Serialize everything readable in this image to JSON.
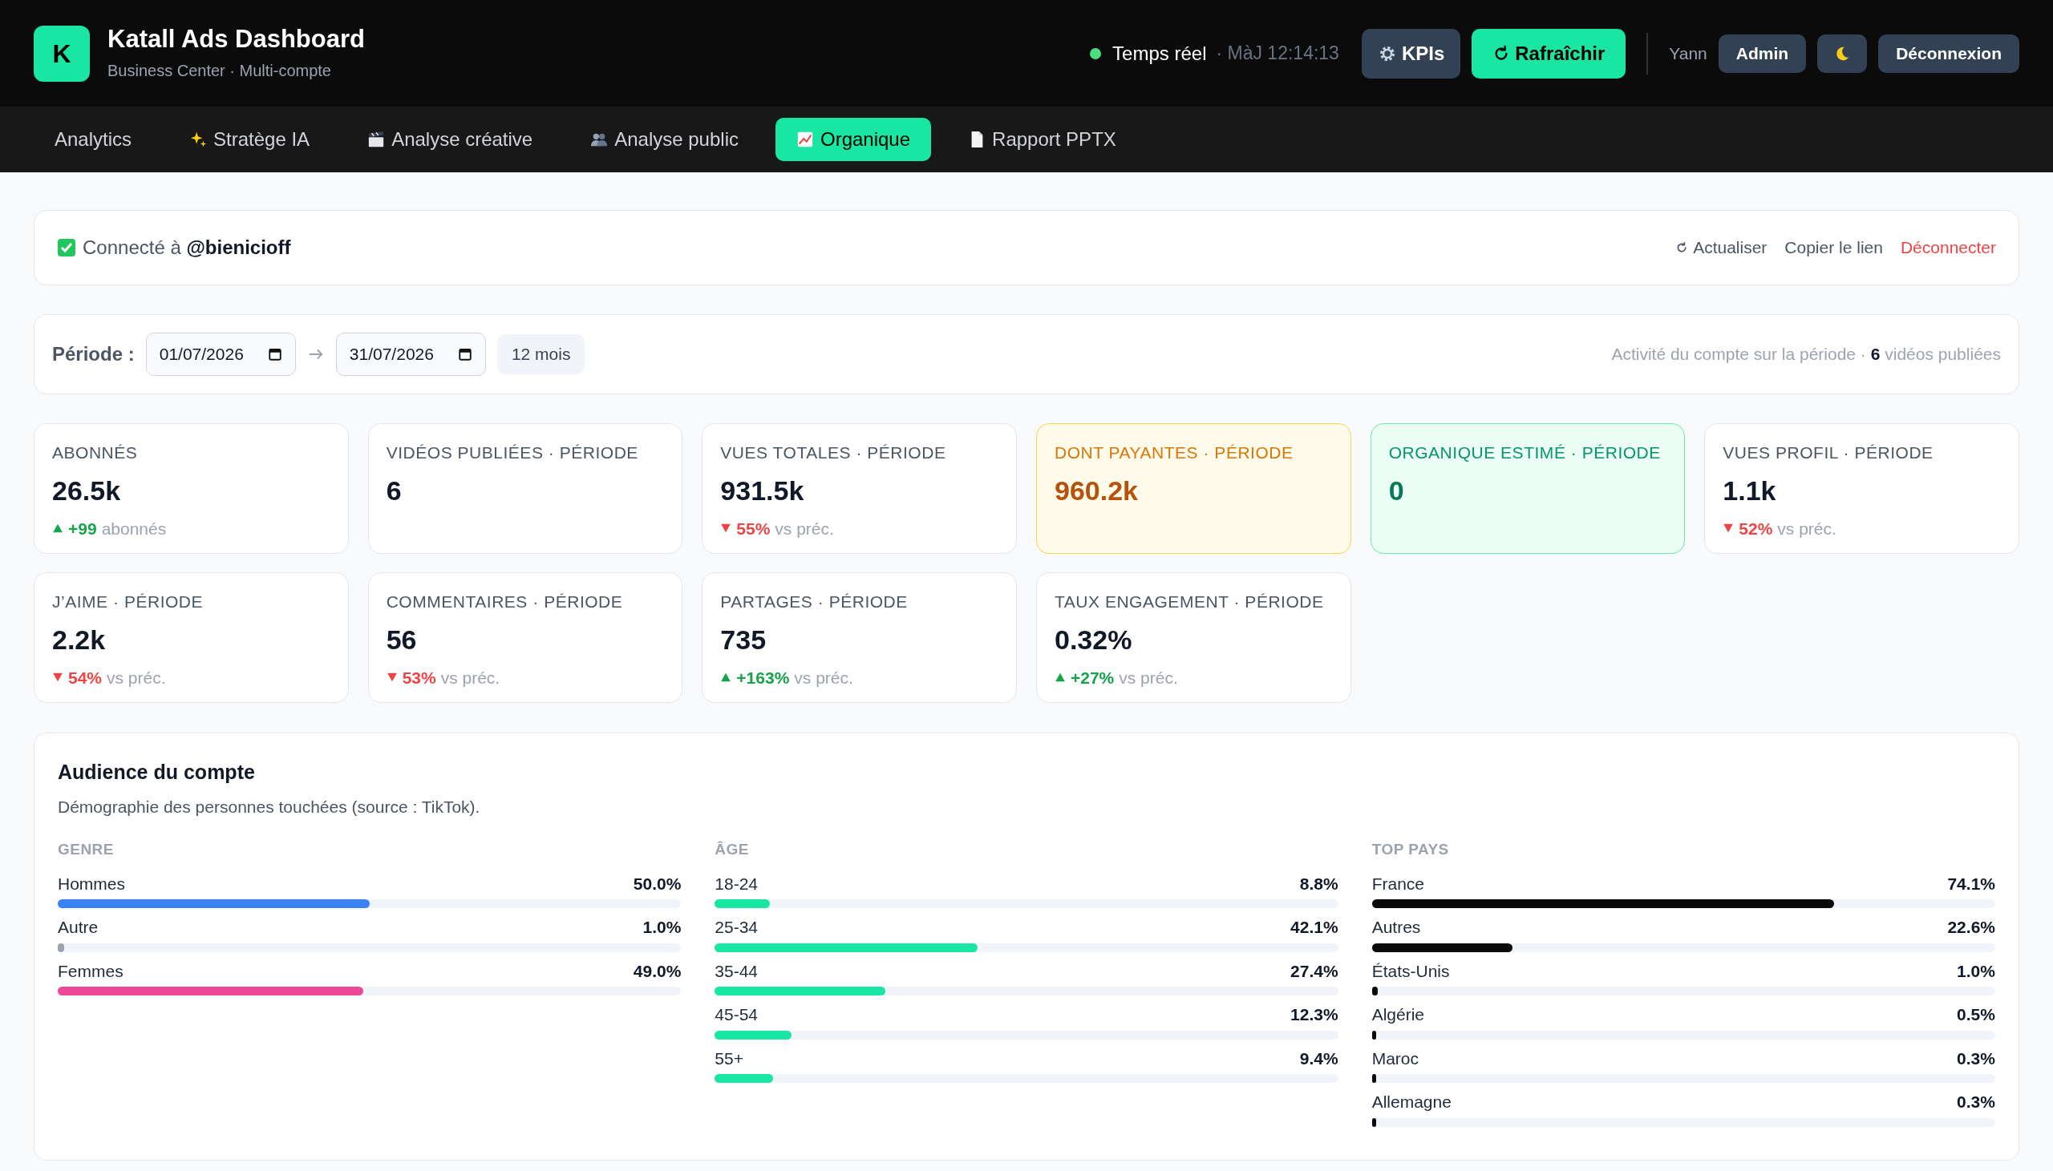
{
  "header": {
    "logo": "K",
    "title": "Katall Ads Dashboard",
    "subtitle": "Business Center · Multi-compte",
    "status": {
      "label": "Temps réel",
      "live": true,
      "updated": "· MàJ 12:14:13"
    },
    "kpis_button": "KPIs",
    "refresh_button": "Rafraîchir",
    "user": "Yann",
    "role": "Admin",
    "logout_button": "Déconnexion"
  },
  "tabs": [
    {
      "label": "Analytics",
      "selected": false
    },
    {
      "label": "Stratège IA",
      "selected": false
    },
    {
      "label": "Analyse créative",
      "selected": false
    },
    {
      "label": "Analyse public",
      "selected": false
    },
    {
      "label": "Organique",
      "selected": true
    },
    {
      "label": "Rapport PPTX",
      "selected": false
    }
  ],
  "connection": {
    "connected": true,
    "text": "Connecté à **@bienicioff**",
    "actions": [
      {
        "label": "Actualiser",
        "kind": "refresh"
      },
      {
        "label": "Copier le lien",
        "kind": "link"
      },
      {
        "label": "Déconnecter",
        "kind": "danger"
      }
    ]
  },
  "period": {
    "label": "Période :",
    "start": "01/07/2026",
    "end": "31/07/2026",
    "preset": "12 mois",
    "summary": "Activité du compte sur la période · **6** vidéos publiées"
  },
  "kpis": [
    {
      "label": "ABONNÉS",
      "value": "26.5k",
      "kind": "plain",
      "delta": {
        "up": true,
        "value": "+99",
        "note": "abonnés"
      }
    },
    {
      "label": "VIDÉOS PUBLIÉES · PÉRIODE",
      "value": "6",
      "kind": "plain"
    },
    {
      "label": "VUES TOTALES · PÉRIODE",
      "value": "931.5k",
      "kind": "plain",
      "delta": {
        "up": false,
        "value": "55%",
        "note": "vs préc."
      }
    },
    {
      "label": "DONT PAYANTES · PÉRIODE",
      "value": "960.2k",
      "kind": "warning"
    },
    {
      "label": "ORGANIQUE ESTIMÉ · PÉRIODE",
      "value": "0",
      "kind": "success"
    },
    {
      "label": "VUES PROFIL · PÉRIODE",
      "value": "1.1k",
      "kind": "plain",
      "delta": {
        "up": false,
        "value": "52%",
        "note": "vs préc."
      }
    },
    {
      "label": "J’AIME · PÉRIODE",
      "value": "2.2k",
      "kind": "plain",
      "delta": {
        "up": false,
        "value": "54%",
        "note": "vs préc."
      }
    },
    {
      "label": "COMMENTAIRES · PÉRIODE",
      "value": "56",
      "kind": "plain",
      "delta": {
        "up": false,
        "value": "53%",
        "note": "vs préc."
      }
    },
    {
      "label": "PARTAGES · PÉRIODE",
      "value": "735",
      "kind": "plain",
      "delta": {
        "up": true,
        "value": "+163%",
        "note": "vs préc."
      }
    },
    {
      "label": "TAUX ENGAGEMENT · PÉRIODE",
      "value": "0.32%",
      "kind": "plain",
      "delta": {
        "up": true,
        "value": "+27%",
        "note": "vs préc."
      }
    }
  ],
  "audience": {
    "title": "Audience du compte",
    "subtitle": "Démographie des personnes touchées (source : TikTok).",
    "groups": [
      {
        "heading": "GENRE",
        "rows": [
          {
            "label": "Hommes",
            "value": "50.0%",
            "level": 0.5,
            "color": "#3b82f6"
          },
          {
            "label": "Autre",
            "value": "1.0%",
            "level": 0.01,
            "color": "#9ca3af"
          },
          {
            "label": "Femmes",
            "value": "49.0%",
            "level": 0.49,
            "color": "#ec4899"
          }
        ]
      },
      {
        "heading": "ÂGE",
        "rows": [
          {
            "label": "18-24",
            "value": "8.8%",
            "level": 0.088,
            "color": "#19e6a2"
          },
          {
            "label": "25-34",
            "value": "42.1%",
            "level": 0.421,
            "color": "#19e6a2"
          },
          {
            "label": "35-44",
            "value": "27.4%",
            "level": 0.274,
            "color": "#19e6a2"
          },
          {
            "label": "45-54",
            "value": "12.3%",
            "level": 0.123,
            "color": "#19e6a2"
          },
          {
            "label": "55+",
            "value": "9.4%",
            "level": 0.094,
            "color": "#19e6a2"
          }
        ]
      },
      {
        "heading": "TOP PAYS",
        "rows": [
          {
            "label": "France",
            "value": "74.1%",
            "level": 0.741,
            "color": "#0a0a0a"
          },
          {
            "label": "Autres",
            "value": "22.6%",
            "level": 0.226,
            "color": "#0a0a0a"
          },
          {
            "label": "États-Unis",
            "value": "1.0%",
            "level": 0.01,
            "color": "#0a0a0a"
          },
          {
            "label": "Algérie",
            "value": "0.5%",
            "level": 0.005,
            "color": "#0a0a0a"
          },
          {
            "label": "Maroc",
            "value": "0.3%",
            "level": 0.003,
            "color": "#0a0a0a"
          },
          {
            "label": "Allemagne",
            "value": "0.3%",
            "level": 0.003,
            "color": "#0a0a0a"
          }
        ]
      }
    ]
  }
}
